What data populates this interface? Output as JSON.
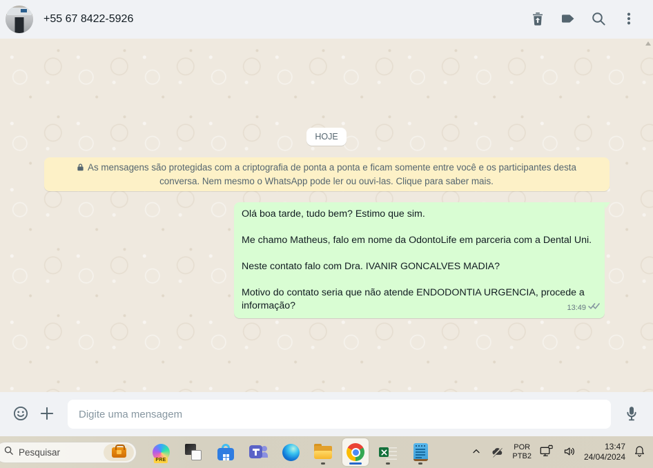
{
  "header": {
    "contact_name": "+55 67 8422-5926",
    "actions": [
      {
        "icon": "trash-icon"
      },
      {
        "icon": "label-icon"
      },
      {
        "icon": "search-icon"
      },
      {
        "icon": "menu-kebab-icon"
      }
    ]
  },
  "chat": {
    "date_divider": "HOJE",
    "encryption_notice": "As mensagens são protegidas com a criptografia de ponta a ponta e ficam somente entre você e os participantes desta conversa. Nem mesmo o WhatsApp pode ler ou ouvi-las. Clique para saber mais.",
    "messages": [
      {
        "direction": "outgoing",
        "paragraphs": [
          "Olá boa tarde, tudo bem? Estimo que sim.",
          "Me chamo Matheus, falo em nome da OdontoLife em parceria com a Dental Uni.",
          "Neste contato falo com Dra. IVANIR GONCALVES MADIA?",
          "Motivo do contato seria que não atende ENDODONTIA URGENCIA, procede a informação?"
        ],
        "time": "13:49",
        "status": "delivered"
      }
    ]
  },
  "composer": {
    "placeholder": "Digite uma mensagem"
  },
  "taskbar": {
    "search_placeholder": "Pesquisar",
    "copilot_badge": "PRE",
    "apps": [
      {
        "name": "Copilot",
        "state": "pinned"
      },
      {
        "name": "Task View",
        "state": "pinned"
      },
      {
        "name": "Microsoft Store",
        "state": "pinned"
      },
      {
        "name": "Microsoft Teams",
        "state": "pinned"
      },
      {
        "name": "Microsoft Edge",
        "state": "pinned"
      },
      {
        "name": "File Explorer",
        "state": "running"
      },
      {
        "name": "Google Chrome",
        "state": "active"
      },
      {
        "name": "Excel",
        "state": "running"
      },
      {
        "name": "Notepad",
        "state": "running"
      }
    ],
    "tray": {
      "language_top": "POR",
      "language_bottom": "PTB2",
      "time": "13:47",
      "date": "24/04/2024"
    }
  },
  "colors": {
    "header_bg": "#f0f2f5",
    "chat_bg": "#efe9df",
    "bubble_green": "#d9fdd3",
    "banner_yellow": "#fdf1c7",
    "icon_slate": "#54656f",
    "taskbar_bg": "#d8d2c2",
    "chrome_active_bar": "#2667c9"
  }
}
